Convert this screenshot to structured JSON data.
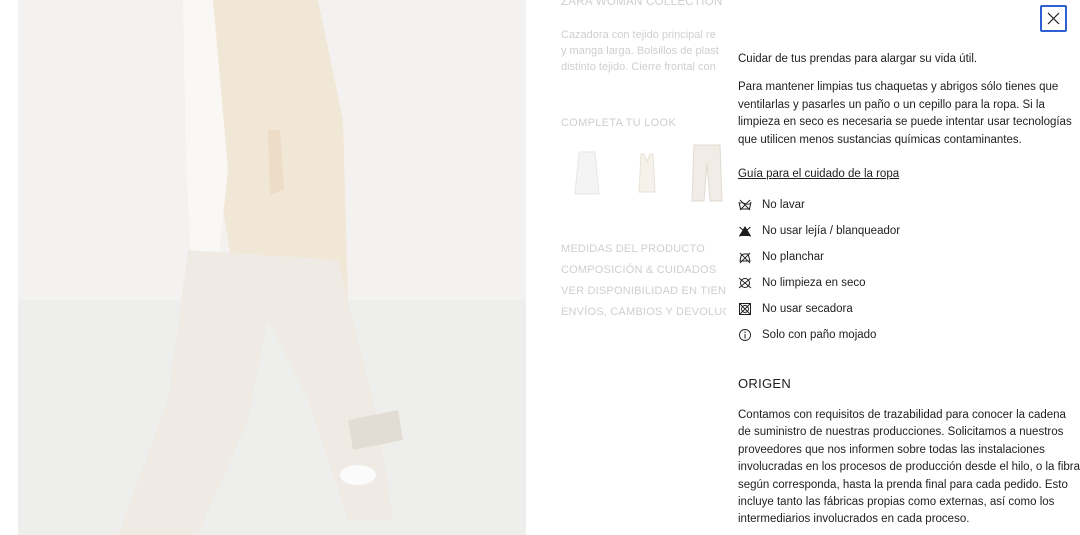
{
  "product": {
    "collection": "ZARA WOMAN COLLECTION",
    "description": "Cazadora  con tejido principal re\ny manga larga. Bolsillos de plast\ndistinto tejido. Cierre frontal con",
    "complete_look_title": "COMPLETA TU LOOK",
    "complete_look_items": [
      "shirt-thumbnail",
      "top-thumbnail",
      "trousers-thumbnail"
    ],
    "links": [
      "MEDIDAS DEL PRODUCTO",
      "COMPOSICIÓN & CUIDADOS",
      "VER DISPONIBILIDAD EN TIENDA",
      "ENVÍOS, CAMBIOS Y DEVOLUCIONES"
    ]
  },
  "panel": {
    "close_icon": "close-icon",
    "intro": "Cuidar de tus prendas para alargar su vida útil.",
    "body": "Para mantener limpias tus chaquetas y abrigos sólo tienes que ventilarlas y pasarles un paño o un cepillo para la ropa. Si la limpieza en seco es necesaria se puede intentar usar tecnologías que utilicen menos sustancias químicas contaminantes.",
    "guide_link": "Guía para el cuidado de la ropa",
    "care": [
      {
        "icon": "no-wash-icon",
        "label": "No lavar"
      },
      {
        "icon": "no-bleach-icon",
        "label": "No usar lejía / blanqueador"
      },
      {
        "icon": "no-iron-icon",
        "label": "No planchar"
      },
      {
        "icon": "no-dry-clean-icon",
        "label": "No limpieza en seco"
      },
      {
        "icon": "no-tumble-dry-icon",
        "label": "No usar secadora"
      },
      {
        "icon": "info-icon",
        "label": "Solo con paño mojado"
      }
    ],
    "origin_title": "ORIGEN",
    "origin_text": "Contamos con requisitos de trazabilidad para conocer la cadena de suministro de nuestras producciones. Solicitamos a nuestros proveedores que nos informen sobre todas las instalaciones involucradas en los procesos de producción desde el hilo, o la fibra según corresponda, hasta la prenda final para cada pedido. Esto incluye tanto las fábricas propias como externas, así como los intermediarios involucrados en cada proceso."
  },
  "colors": {
    "focus_ring": "#2f5fd0",
    "panel_text": "#1e1e1e",
    "dimmed_text": "#cfcfcf"
  }
}
